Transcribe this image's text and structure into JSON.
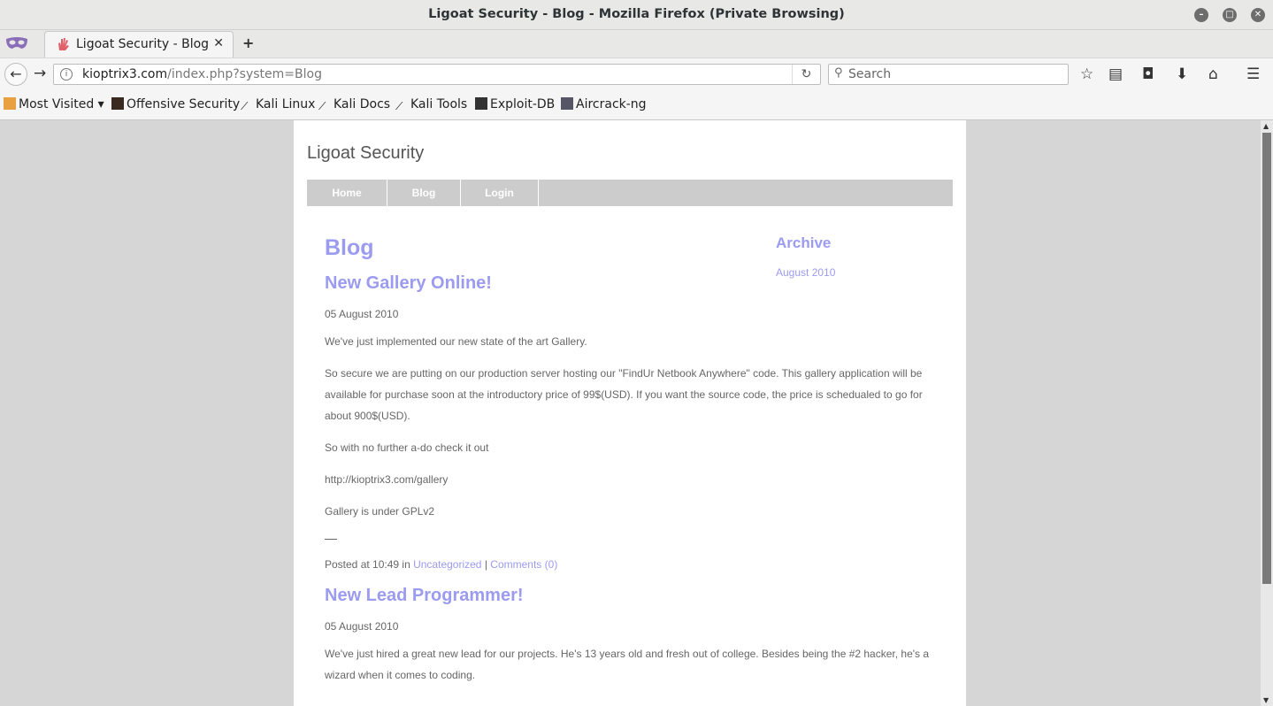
{
  "window": {
    "title": "Ligoat Security - Blog - Mozilla Firefox (Private Browsing)"
  },
  "tab": {
    "label": "Ligoat Security - Blog"
  },
  "url": {
    "host": "kioptrix3.com",
    "path": "/index.php?system=Blog"
  },
  "search": {
    "placeholder": "Search"
  },
  "bookmarks": [
    {
      "label": "Most Visited ▾"
    },
    {
      "label": "Offensive Security"
    },
    {
      "label": "Kali Linux"
    },
    {
      "label": "Kali Docs"
    },
    {
      "label": "Kali Tools"
    },
    {
      "label": "Exploit-DB"
    },
    {
      "label": "Aircrack-ng"
    }
  ],
  "site": {
    "title": "Ligoat Security",
    "menu": [
      {
        "label": "Home"
      },
      {
        "label": "Blog"
      },
      {
        "label": "Login"
      }
    ],
    "heading": "Blog",
    "archive": {
      "heading": "Archive",
      "link": "August 2010"
    },
    "posts": [
      {
        "title": "New Gallery Online!",
        "date": "05 August 2010",
        "p1": "We've just implemented our new state of the art Gallery.",
        "p2": "So secure we are putting on our production server hosting our \"FindUr Netbook Anywhere\" code. This gallery application will be available for purchase soon at the introductory price of 99$(USD). If you want the source code, the price is schedualed to go for about 900$(USD).",
        "p3": "So with no further a-do check it out",
        "p4": "http://kioptrix3.com/gallery",
        "p5": "Gallery is under GPLv2",
        "posted": "Posted at 10:49 in",
        "category": "Uncategorized",
        "divider": "|",
        "comments": "Comments (0)"
      },
      {
        "title": "New Lead Programmer!",
        "date": "05 August 2010",
        "p1": "We've just hired a great new lead for our projects. He's 13 years old and fresh out of college. Besides being the #2 hacker, he's a wizard when it comes to coding."
      }
    ]
  },
  "colors": {
    "link": "#9b9bf0",
    "menu_bg": "#cccccc",
    "page_bg": "#d6d6d6"
  }
}
